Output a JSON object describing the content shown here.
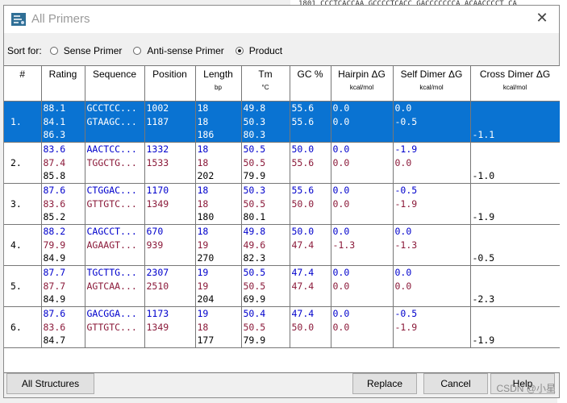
{
  "background": {
    "top_text": "1801   CCCTCACCAA  GCCCCTCACC  GACCCCCCCA  ACAACCCCT  CA"
  },
  "window": {
    "title": "All Primers",
    "close_glyph": "✕"
  },
  "sort": {
    "label": "Sort for:",
    "options": [
      {
        "label": "Sense Primer",
        "selected": false
      },
      {
        "label": "Anti-sense Primer",
        "selected": false
      },
      {
        "label": "Product",
        "selected": true
      }
    ]
  },
  "table": {
    "columns": [
      {
        "label": "#",
        "unit": ""
      },
      {
        "label": "Rating",
        "unit": ""
      },
      {
        "label": "Sequence",
        "unit": ""
      },
      {
        "label": "Position",
        "unit": ""
      },
      {
        "label": "Length",
        "unit": "bp"
      },
      {
        "label": "Tm",
        "unit": "°C"
      },
      {
        "label": "GC %",
        "unit": ""
      },
      {
        "label": "Hairpin ΔG",
        "unit": "kcal/mol"
      },
      {
        "label": "Self Dimer ΔG",
        "unit": "kcal/mol"
      },
      {
        "label": "Cross Dimer ΔG",
        "unit": "kcal/mol"
      }
    ],
    "rows": [
      {
        "num": "1.",
        "selected": true,
        "sense": {
          "rating": "88.1",
          "seq": "GCCTCC...",
          "pos": "1002",
          "len": "18",
          "tm": "49.8",
          "gc": "55.6",
          "hairpin": "0.0",
          "self": "0.0"
        },
        "anti": {
          "rating": "84.1",
          "seq": "GTAAGC...",
          "pos": "1187",
          "len": "18",
          "tm": "50.3",
          "gc": "55.6",
          "hairpin": "0.0",
          "self": "-0.5"
        },
        "product": {
          "rating": "86.3",
          "len": "186",
          "tm": "80.3",
          "cross": "-1.1"
        }
      },
      {
        "num": "2.",
        "selected": false,
        "sense": {
          "rating": "83.6",
          "seq": "AACTCC...",
          "pos": "1332",
          "len": "18",
          "tm": "50.5",
          "gc": "50.0",
          "hairpin": "0.0",
          "self": "-1.9"
        },
        "anti": {
          "rating": "87.4",
          "seq": "TGGCTG...",
          "pos": "1533",
          "len": "18",
          "tm": "50.5",
          "gc": "55.6",
          "hairpin": "0.0",
          "self": "0.0"
        },
        "product": {
          "rating": "85.8",
          "len": "202",
          "tm": "79.9",
          "cross": "-1.0"
        }
      },
      {
        "num": "3.",
        "selected": false,
        "sense": {
          "rating": "87.6",
          "seq": "CTGGAC...",
          "pos": "1170",
          "len": "18",
          "tm": "50.3",
          "gc": "55.6",
          "hairpin": "0.0",
          "self": "-0.5"
        },
        "anti": {
          "rating": "83.6",
          "seq": "GTTGTC...",
          "pos": "1349",
          "len": "18",
          "tm": "50.5",
          "gc": "50.0",
          "hairpin": "0.0",
          "self": "-1.9"
        },
        "product": {
          "rating": "85.2",
          "len": "180",
          "tm": "80.1",
          "cross": "-1.9"
        }
      },
      {
        "num": "4.",
        "selected": false,
        "sense": {
          "rating": "88.2",
          "seq": "CAGCCT...",
          "pos": "670",
          "len": "18",
          "tm": "49.8",
          "gc": "50.0",
          "hairpin": "0.0",
          "self": "0.0"
        },
        "anti": {
          "rating": "79.9",
          "seq": "AGAAGT...",
          "pos": "939",
          "len": "19",
          "tm": "49.6",
          "gc": "47.4",
          "hairpin": "-1.3",
          "self": "-1.3"
        },
        "product": {
          "rating": "84.9",
          "len": "270",
          "tm": "82.3",
          "cross": "-0.5"
        }
      },
      {
        "num": "5.",
        "selected": false,
        "sense": {
          "rating": "87.7",
          "seq": "TGCTTG...",
          "pos": "2307",
          "len": "19",
          "tm": "50.5",
          "gc": "47.4",
          "hairpin": "0.0",
          "self": "0.0"
        },
        "anti": {
          "rating": "87.7",
          "seq": "AGTCAA...",
          "pos": "2510",
          "len": "19",
          "tm": "50.5",
          "gc": "47.4",
          "hairpin": "0.0",
          "self": "0.0"
        },
        "product": {
          "rating": "84.9",
          "len": "204",
          "tm": "69.9",
          "cross": "-2.3"
        }
      },
      {
        "num": "6.",
        "selected": false,
        "sense": {
          "rating": "87.6",
          "seq": "GACGGA...",
          "pos": "1173",
          "len": "19",
          "tm": "50.4",
          "gc": "47.4",
          "hairpin": "0.0",
          "self": "-0.5"
        },
        "anti": {
          "rating": "83.6",
          "seq": "GTTGTC...",
          "pos": "1349",
          "len": "18",
          "tm": "50.5",
          "gc": "50.0",
          "hairpin": "0.0",
          "self": "-1.9"
        },
        "product": {
          "rating": "84.7",
          "len": "177",
          "tm": "79.9",
          "cross": "-1.9"
        }
      }
    ]
  },
  "buttons": {
    "all_structures": "All Structures",
    "replace": "Replace",
    "cancel": "Cancel",
    "help": "Help"
  },
  "watermark": "CSDN @小星",
  "colors": {
    "selection": "#0a73d2",
    "sense_text": "#0000cc",
    "anti_text": "#8b1a3a"
  }
}
